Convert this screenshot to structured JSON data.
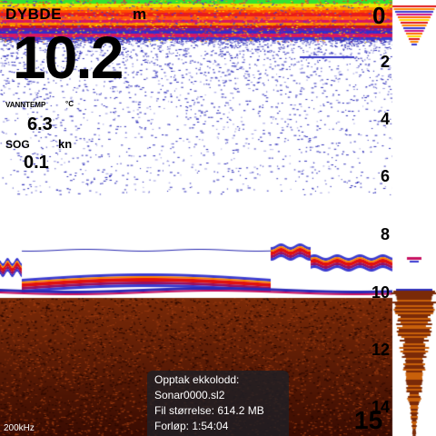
{
  "depth_panel": {
    "label": "DYBDE",
    "unit": "m",
    "value": "10.2"
  },
  "water_temp": {
    "label": "VANNTEMP",
    "unit": "°C",
    "value": "6.3"
  },
  "speed": {
    "label": "SOG",
    "unit": "kn",
    "value": "0.1"
  },
  "depth_scale": {
    "top": "0",
    "ticks": [
      "2",
      "4",
      "6",
      "8",
      "10",
      "12",
      "14"
    ],
    "bottom": "15"
  },
  "frequency": "200kHz",
  "recording": {
    "title": "Opptak ekkolodd:",
    "file_name": "Sonar0000.sl2",
    "file_size": "Fil størrelse: 614.2 MB",
    "elapsed": "Forløp: 1:54:04"
  },
  "colors": {
    "surface_band": "#22dd22",
    "bottom_strong": "#cc1010",
    "clutter": "#2233cc",
    "seabed": "#5a1a06"
  }
}
